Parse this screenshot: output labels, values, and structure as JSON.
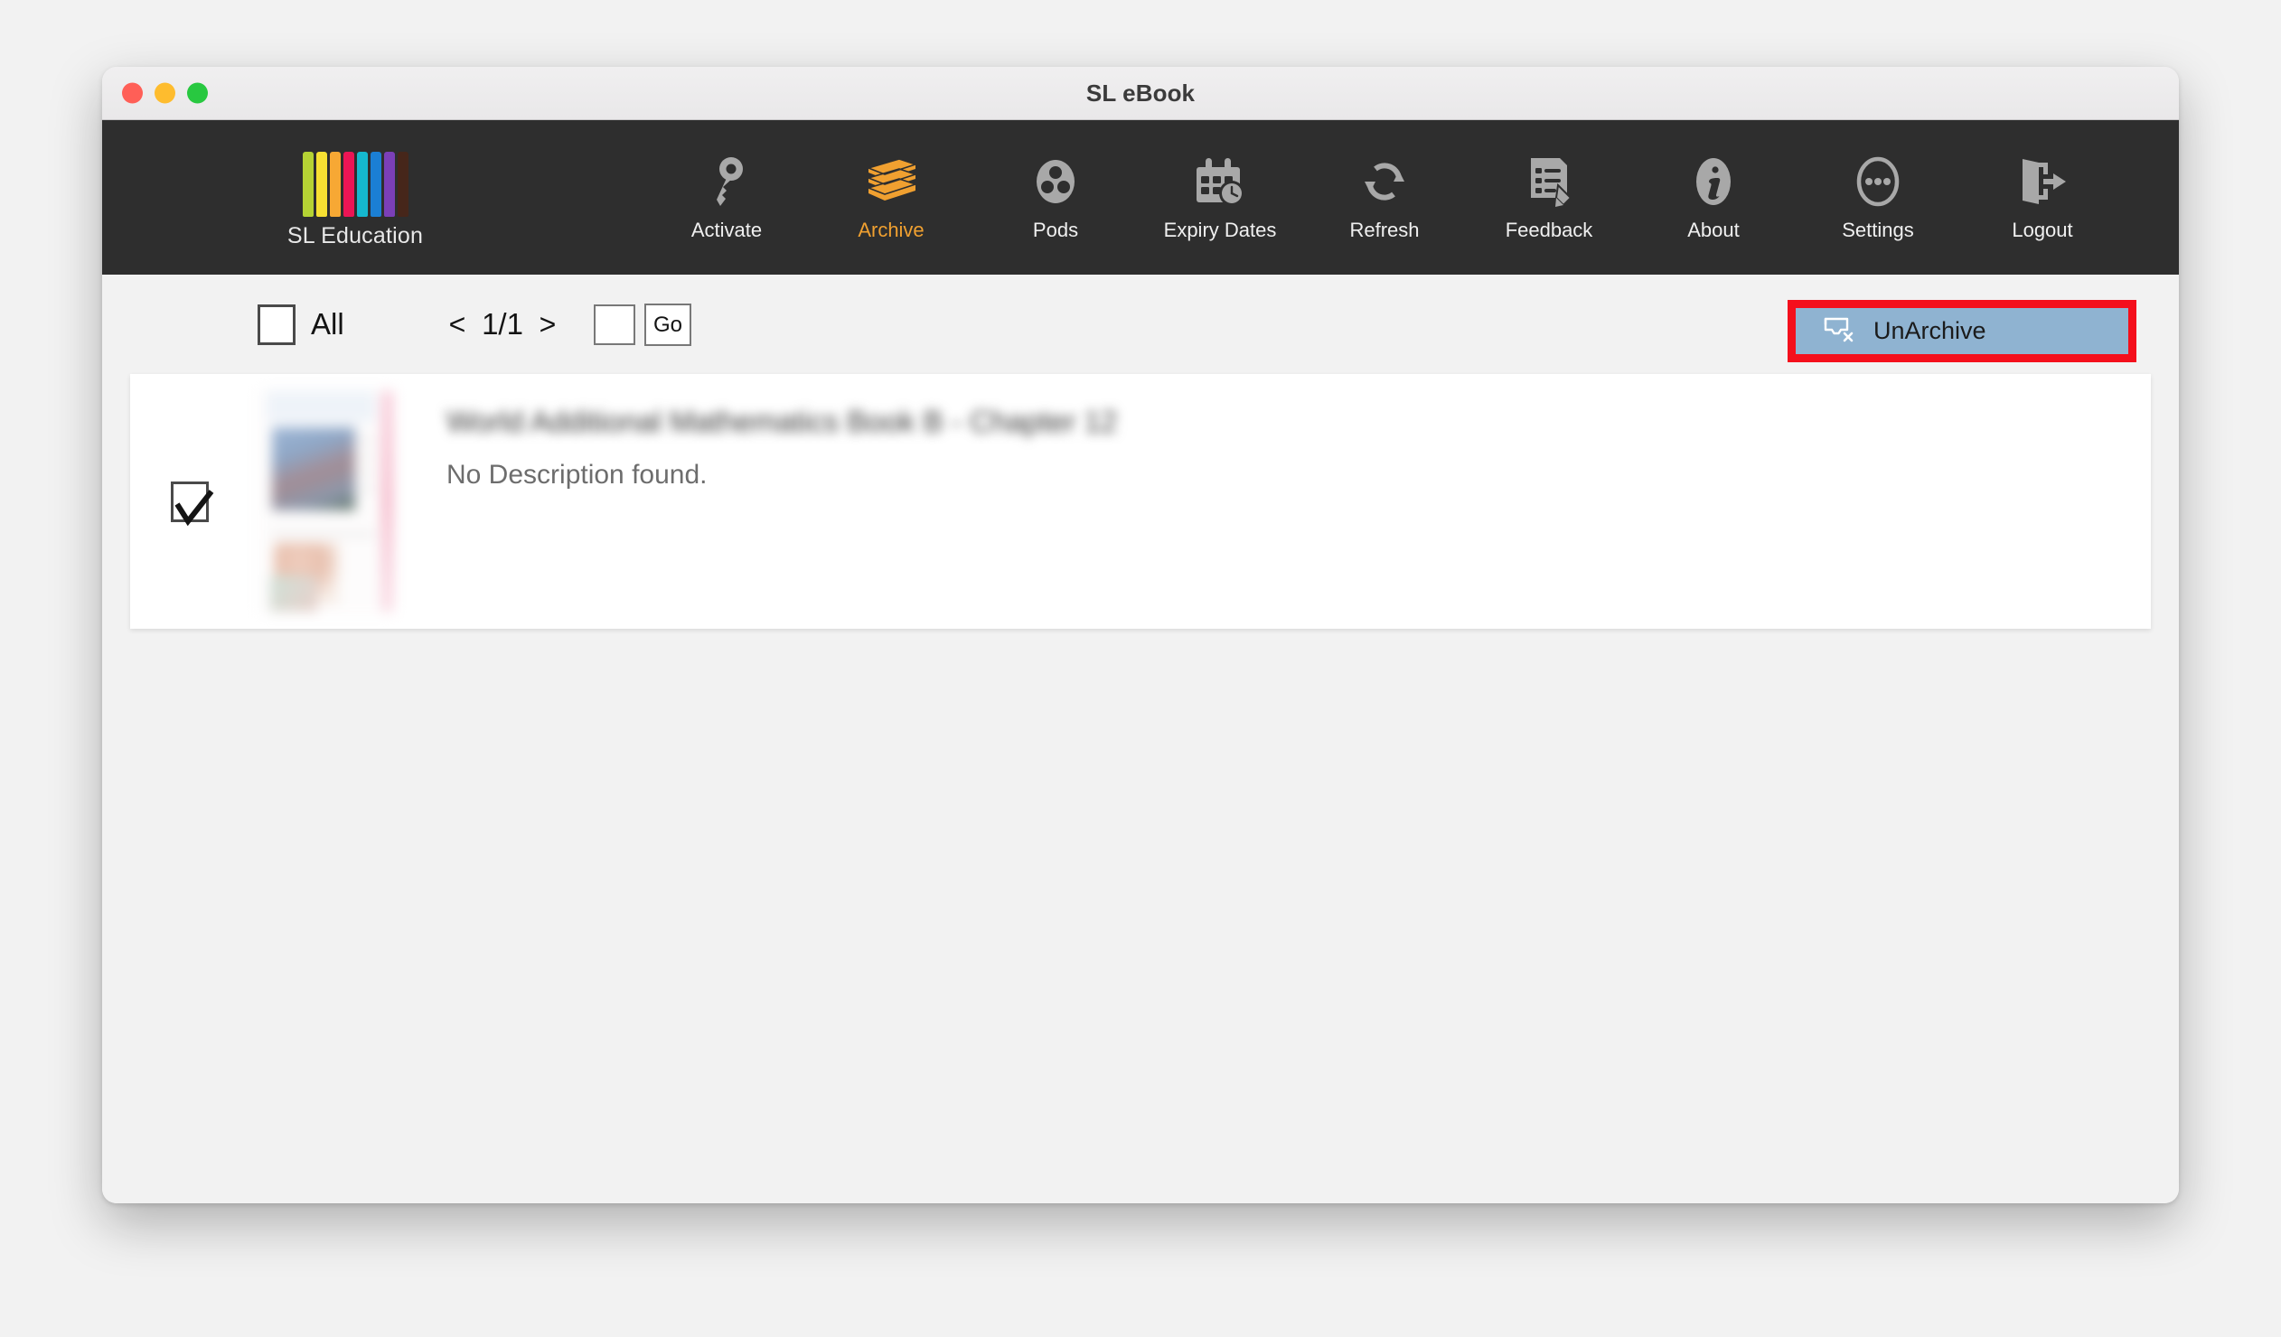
{
  "window": {
    "title": "SL eBook",
    "traffic_lights": [
      "close",
      "minimize",
      "zoom"
    ]
  },
  "brand": {
    "name": "SL Education",
    "bar_colors": [
      "#b5d334",
      "#f7e032",
      "#f7a834",
      "#ec1555",
      "#15b8ce",
      "#1b7fd4",
      "#7b3fb8",
      "#46261a"
    ]
  },
  "toolbar": {
    "items": [
      {
        "id": "activate",
        "label": "Activate",
        "icon": "key-icon",
        "active": false
      },
      {
        "id": "archive",
        "label": "Archive",
        "icon": "books-stack-icon",
        "active": true
      },
      {
        "id": "pods",
        "label": "Pods",
        "icon": "pods-circle-icon",
        "active": false
      },
      {
        "id": "expiry-dates",
        "label": "Expiry Dates",
        "icon": "calendar-clock-icon",
        "active": false
      },
      {
        "id": "refresh",
        "label": "Refresh",
        "icon": "refresh-icon",
        "active": false
      },
      {
        "id": "feedback",
        "label": "Feedback",
        "icon": "feedback-pencil-icon",
        "active": false
      },
      {
        "id": "about",
        "label": "About",
        "icon": "info-icon",
        "active": false
      },
      {
        "id": "settings",
        "label": "Settings",
        "icon": "ellipsis-circle-icon",
        "active": false
      },
      {
        "id": "logout",
        "label": "Logout",
        "icon": "logout-door-icon",
        "active": false
      }
    ],
    "active_color": "#f0a030",
    "inactive_color": "#f0f0f0",
    "background": "#2e2e2e"
  },
  "actionbar": {
    "select_all_label": "All",
    "select_all_checked": false,
    "prev_label": "<",
    "next_label": ">",
    "page_indicator": "1/1",
    "page_input_value": "",
    "page_input_placeholder": "",
    "go_label": "Go",
    "unarchive_label": "UnArchive",
    "unarchive_icon": "inbox-remove-icon",
    "unarchive_background": "#8fb3d1",
    "highlight_color": "#f40f1c"
  },
  "list": {
    "rows": [
      {
        "checked": true,
        "title": "World Additional Mathematics Book B - Chapter 12",
        "description": "No Description found.",
        "thumbnail": "book-cover-thumbnail"
      }
    ]
  }
}
